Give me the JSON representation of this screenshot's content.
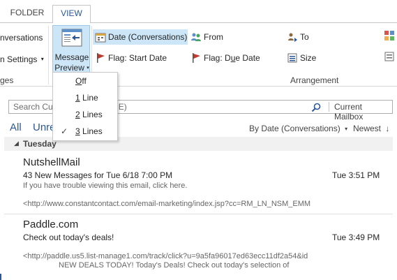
{
  "tabs": {
    "folder": "FOLDER",
    "view": "VIEW"
  },
  "ribbon": {
    "left_cut": {
      "conversations": "nversations",
      "settings": "n Settings",
      "settings_caret": "▾",
      "group_label": "ges"
    },
    "message_preview": {
      "line1": "Message",
      "line2": "Preview",
      "caret": "▾"
    },
    "arrangement": {
      "group_label": "Arrangement",
      "date_conversations": "Date (Conversations)",
      "from": "From",
      "to": "To",
      "flag_start_date": "Flag: Start Date",
      "flag_due_date_pre": "Flag: D",
      "flag_due_date_ul": "u",
      "flag_due_date_post": "e Date",
      "size": "Size"
    }
  },
  "preview_menu": {
    "items": [
      {
        "ul": "O",
        "rest": "ff",
        "checked": false
      },
      {
        "ul": "1",
        "rest": " Line",
        "checked": false
      },
      {
        "ul": "2",
        "rest": " Lines",
        "checked": false
      },
      {
        "ul": "3",
        "rest": " Lines",
        "checked": true
      }
    ],
    "check_glyph": "✓"
  },
  "search": {
    "text_visible": "Search Curr",
    "text_tail": "E)",
    "scope": "Current Mailbox"
  },
  "list": {
    "filter_all": "All",
    "filter_unread": "Unre",
    "sort_by": "By Date (Conversations)",
    "sort_caret": "▾",
    "order": "Newest",
    "order_arrow": "↓",
    "group_title": "Tuesday",
    "group_triangle": "◢",
    "messages": [
      {
        "sender": "NutshellMail",
        "subject": "43 New Messages for Tue 6/18 7:00 PM",
        "time": "Tue 3:51 PM",
        "preview1": "If you have trouble viewing this email, click here.",
        "preview2": "<http://www.constantcontact.com/email-marketing/index.jsp?cc=RM_LN_NSM_EMM"
      },
      {
        "sender": "Paddle.com",
        "subject": "Check out today's deals!",
        "time": "Tue 3:49 PM",
        "preview1": "<http://paddle.us5.list-manage1.com/track/click?u=9a5fa96017ed63ecc11df2a54&id",
        "preview2": "NEW DEALS TODAY!  Today's Deals!  Check out today's selection of"
      }
    ]
  },
  "colors": {
    "accent": "#2b579a",
    "selected_bg": "#cde6f7",
    "flag": "#c0392b"
  }
}
